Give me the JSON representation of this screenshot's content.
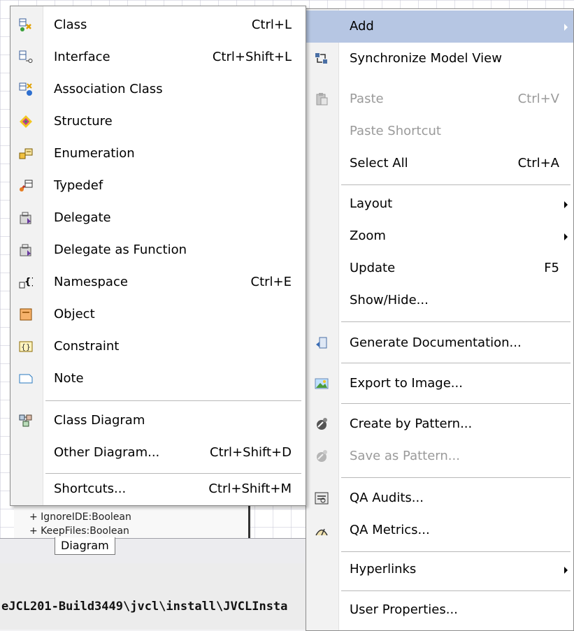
{
  "background": {
    "uml_attributes": [
      "+ IgnoreIDE:Boolean",
      "+ KeepFiles:Boolean"
    ],
    "tab_label": "Diagram",
    "path_text": "eJCL201-Build3449\\jvcl\\install\\JVCLInsta"
  },
  "context_menu": {
    "items": [
      {
        "label": "Add",
        "submenu": true,
        "highlighted": true
      },
      {
        "label": "Synchronize Model View",
        "icon": "sync-icon"
      },
      {
        "label": "Paste",
        "shortcut": "Ctrl+V",
        "disabled": true,
        "icon": "paste-icon"
      },
      {
        "label": "Paste Shortcut",
        "disabled": true
      },
      {
        "label": "Select All",
        "shortcut": "Ctrl+A"
      },
      {
        "label": "Layout",
        "submenu": true
      },
      {
        "label": "Zoom",
        "submenu": true
      },
      {
        "label": "Update",
        "shortcut": "F5"
      },
      {
        "label": "Show/Hide..."
      },
      {
        "label": "Generate Documentation...",
        "icon": "documentation-icon"
      },
      {
        "label": "Export to Image...",
        "icon": "image-icon"
      },
      {
        "label": "Create by Pattern...",
        "icon": "pattern-icon"
      },
      {
        "label": "Save as Pattern...",
        "disabled": true,
        "icon": "save-pattern-icon"
      },
      {
        "label": "QA Audits...",
        "icon": "qa-audits-icon"
      },
      {
        "label": "QA Metrics...",
        "icon": "qa-metrics-icon"
      },
      {
        "label": "Hyperlinks",
        "submenu": true
      },
      {
        "label": "User Properties..."
      }
    ]
  },
  "add_submenu": {
    "items": [
      {
        "label": "Class",
        "shortcut": "Ctrl+L",
        "icon": "class-icon"
      },
      {
        "label": "Interface",
        "shortcut": "Ctrl+Shift+L",
        "icon": "interface-icon"
      },
      {
        "label": "Association Class",
        "icon": "association-class-icon"
      },
      {
        "label": "Structure",
        "icon": "structure-icon"
      },
      {
        "label": "Enumeration",
        "icon": "enumeration-icon"
      },
      {
        "label": "Typedef",
        "icon": "typedef-icon"
      },
      {
        "label": "Delegate",
        "icon": "delegate-icon"
      },
      {
        "label": "Delegate as Function",
        "icon": "delegate-function-icon"
      },
      {
        "label": "Namespace",
        "shortcut": "Ctrl+E",
        "icon": "namespace-icon"
      },
      {
        "label": "Object",
        "icon": "object-icon"
      },
      {
        "label": "Constraint",
        "icon": "constraint-icon"
      },
      {
        "label": "Note",
        "icon": "note-icon"
      },
      {
        "label": "Class Diagram",
        "icon": "class-diagram-icon"
      },
      {
        "label": "Other Diagram...",
        "shortcut": "Ctrl+Shift+D"
      },
      {
        "label": "Shortcuts...",
        "shortcut": "Ctrl+Shift+M"
      }
    ]
  }
}
